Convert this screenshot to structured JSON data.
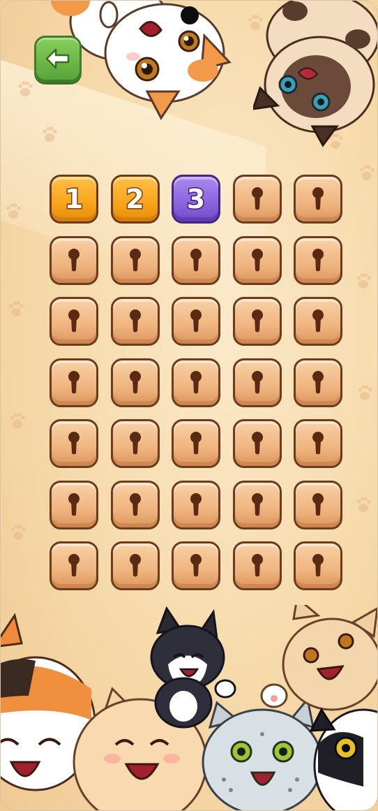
{
  "header": {
    "back_button": {
      "icon": "arrow-left-icon",
      "color": "#6dbb45"
    }
  },
  "levels": [
    {
      "number": "1",
      "state": "completed"
    },
    {
      "number": "2",
      "state": "completed"
    },
    {
      "number": "3",
      "state": "current"
    },
    {
      "number": "",
      "state": "locked"
    },
    {
      "number": "",
      "state": "locked"
    },
    {
      "number": "",
      "state": "locked"
    },
    {
      "number": "",
      "state": "locked"
    },
    {
      "number": "",
      "state": "locked"
    },
    {
      "number": "",
      "state": "locked"
    },
    {
      "number": "",
      "state": "locked"
    },
    {
      "number": "",
      "state": "locked"
    },
    {
      "number": "",
      "state": "locked"
    },
    {
      "number": "",
      "state": "locked"
    },
    {
      "number": "",
      "state": "locked"
    },
    {
      "number": "",
      "state": "locked"
    },
    {
      "number": "",
      "state": "locked"
    },
    {
      "number": "",
      "state": "locked"
    },
    {
      "number": "",
      "state": "locked"
    },
    {
      "number": "",
      "state": "locked"
    },
    {
      "number": "",
      "state": "locked"
    },
    {
      "number": "",
      "state": "locked"
    },
    {
      "number": "",
      "state": "locked"
    },
    {
      "number": "",
      "state": "locked"
    },
    {
      "number": "",
      "state": "locked"
    },
    {
      "number": "",
      "state": "locked"
    },
    {
      "number": "",
      "state": "locked"
    },
    {
      "number": "",
      "state": "locked"
    },
    {
      "number": "",
      "state": "locked"
    },
    {
      "number": "",
      "state": "locked"
    },
    {
      "number": "",
      "state": "locked"
    },
    {
      "number": "",
      "state": "locked"
    },
    {
      "number": "",
      "state": "locked"
    },
    {
      "number": "",
      "state": "locked"
    },
    {
      "number": "",
      "state": "locked"
    },
    {
      "number": "",
      "state": "locked"
    }
  ],
  "colors": {
    "completed": "#f8a41a",
    "current": "#8a63dd",
    "locked": "#efb37e",
    "outline": "#6b3b1e",
    "background": "#f6d9a9"
  },
  "decorations": {
    "cats": [
      "calico-cat-top",
      "siamese-cat-top",
      "calico-cat-bottom-left",
      "fluffy-cream-cat",
      "tuxedo-cat",
      "spotted-gray-cat",
      "tabby-cat",
      "black-white-cat"
    ]
  }
}
